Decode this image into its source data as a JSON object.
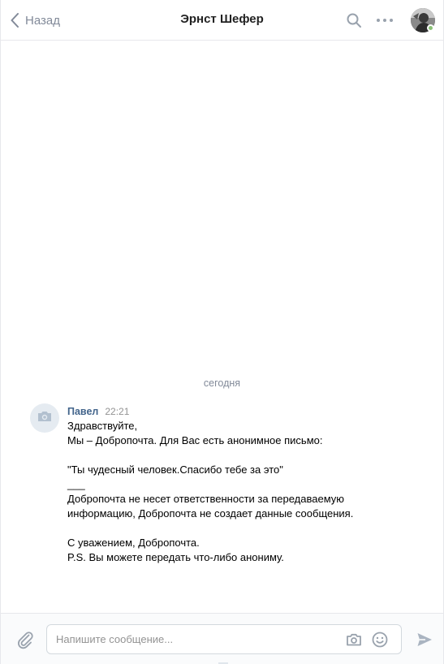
{
  "header": {
    "back_label": "Назад",
    "title": "Эрнст Шефер"
  },
  "chat": {
    "date_divider": "сегодня",
    "message": {
      "author": "Павел",
      "time": "22:21",
      "lines": [
        "Здравствуйте,",
        "Мы – Добропочта. Для Вас есть анонимное письмо:",
        "",
        "\"Ты чудесный человек.Спасибо тебе за это\"",
        "___",
        "Добропочта не несет ответственности за передаваемую",
        "информацию, Добропочта не создает данные сообщения.",
        "",
        "С уважением, Добропочта.",
        "P.S. Вы можете передать что-либо анониму."
      ]
    }
  },
  "composer": {
    "placeholder": "Напишите сообщение...",
    "value": ""
  },
  "colors": {
    "accent": "#42648b",
    "muted": "#828a99",
    "online": "#8ac176",
    "border": "#e7e8ec"
  },
  "icons": {
    "back": "chevron-left-icon",
    "search": "search-icon",
    "more": "more-horizontal-icon",
    "attach": "paperclip-icon",
    "camera": "camera-icon",
    "smile": "smile-icon",
    "send": "send-icon"
  }
}
